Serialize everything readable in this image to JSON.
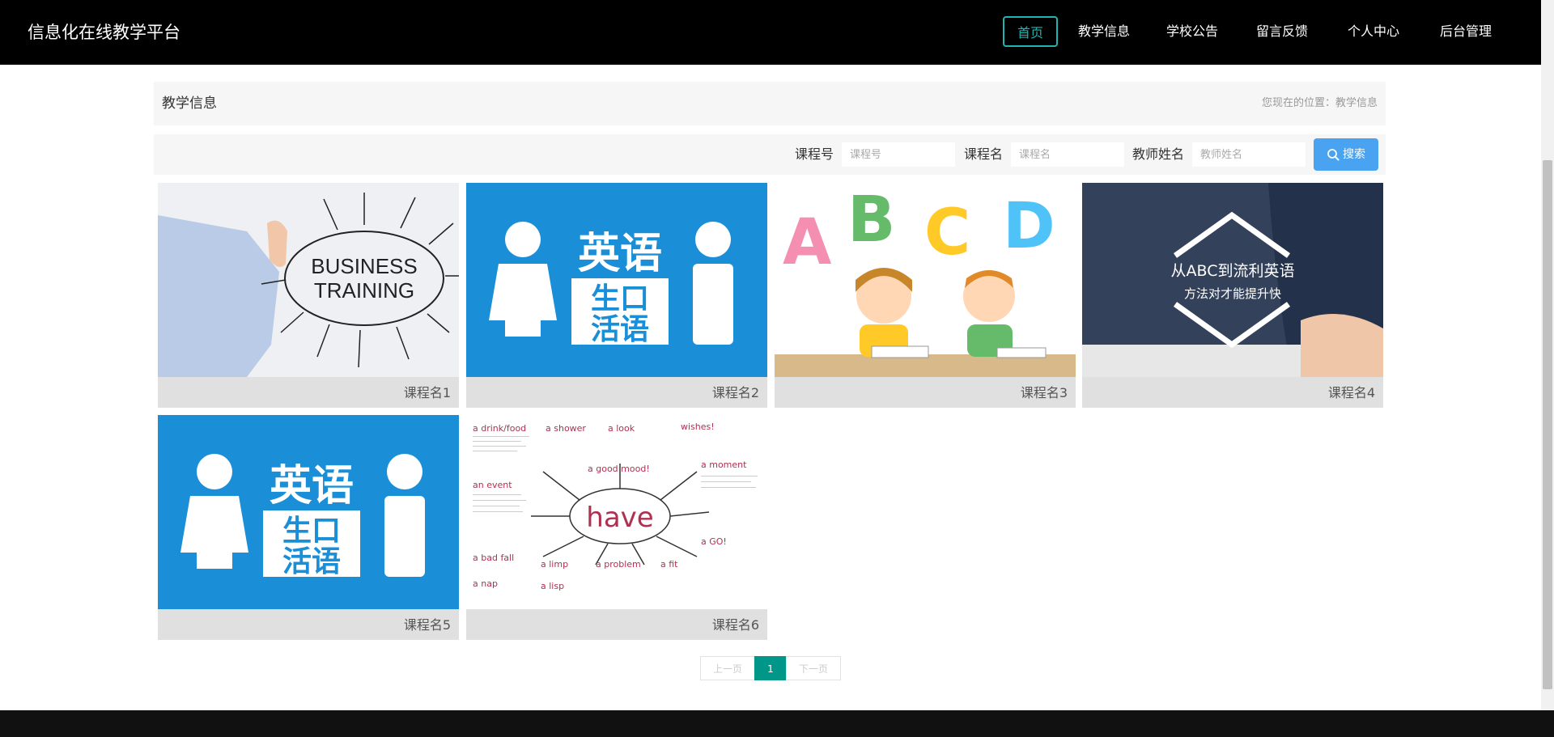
{
  "brand": "信息化在线教学平台",
  "nav": {
    "items": [
      {
        "label": "首页",
        "active": true
      },
      {
        "label": "教学信息",
        "active": false
      },
      {
        "label": "学校公告",
        "active": false
      },
      {
        "label": "留言反馈",
        "active": false
      },
      {
        "label": "个人中心",
        "active": false
      },
      {
        "label": "后台管理",
        "active": false
      }
    ],
    "accent_color": "#1fb5b4"
  },
  "header": {
    "title": "教学信息",
    "breadcrumb": "您现在的位置：教学信息"
  },
  "search": {
    "course_no_label": "课程号",
    "course_no_placeholder": "课程号",
    "course_name_label": "课程名",
    "course_name_placeholder": "课程名",
    "teacher_label": "教师姓名",
    "teacher_placeholder": "教师姓名",
    "button_label": "搜索",
    "button_color": "#4aa3f0"
  },
  "courses": [
    {
      "name": "课程名1",
      "image": "business-training"
    },
    {
      "name": "课程名2",
      "image": "spoken-english"
    },
    {
      "name": "课程名3",
      "image": "abcd-kids"
    },
    {
      "name": "课程名4",
      "image": "abc-to-fluent-english"
    },
    {
      "name": "课程名5",
      "image": "spoken-english"
    },
    {
      "name": "课程名6",
      "image": "have-mindmap"
    }
  ],
  "thumb_text": {
    "business_line1": "BUSINESS",
    "business_line2": "TRAINING",
    "english_top": "英语",
    "english_bottom": "生口\n活语",
    "english_b1": "生口",
    "english_b2": "活语",
    "abc_letters": [
      "A",
      "B",
      "C",
      "D"
    ],
    "fluent_line1": "从ABC到流利英语",
    "fluent_line2": "方法对才能提升快",
    "have_center": "have",
    "have_words": [
      "a drink/food",
      "a shower",
      "a look",
      "wishes!",
      "an event",
      "a good mood!",
      "a moment",
      "a bad fall",
      "a limp",
      "a problem",
      "a fit",
      "a nap",
      "a lisp",
      "a GO!"
    ]
  },
  "pagination": {
    "prev": "上一页",
    "current": "1",
    "next": "下一页",
    "current_color": "#009688"
  }
}
